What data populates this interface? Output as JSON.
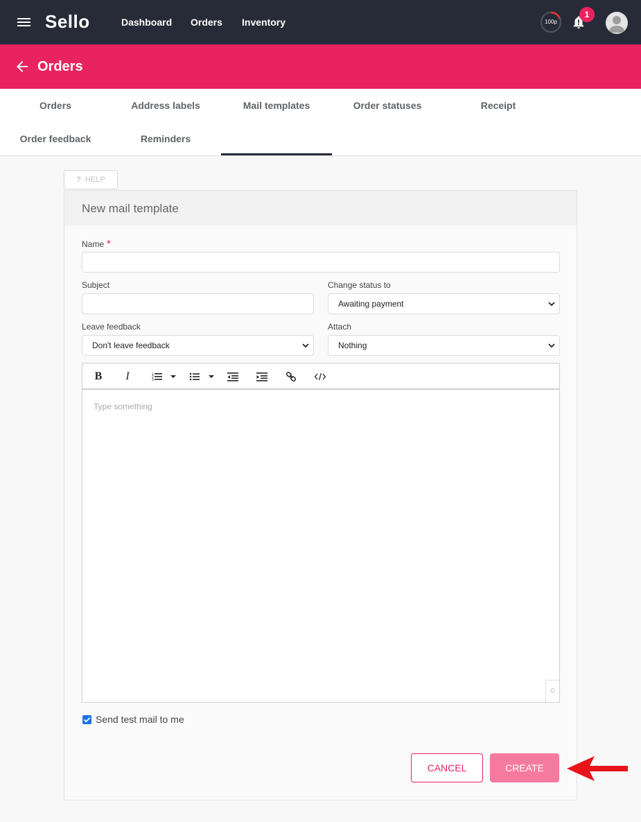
{
  "app": {
    "logo": "Sello"
  },
  "nav": {
    "items": [
      "Dashboard",
      "Orders",
      "Inventory"
    ]
  },
  "header": {
    "credits": "100p",
    "notification_count": "1",
    "accent_color": "#e9235f",
    "topbar_color": "#272b38"
  },
  "page": {
    "title": "Orders"
  },
  "tabs": [
    {
      "label": "Orders"
    },
    {
      "label": "Address labels"
    },
    {
      "label": "Mail templates"
    },
    {
      "label": "Order statuses"
    },
    {
      "label": "Receipt"
    },
    {
      "label": "Order feedback"
    },
    {
      "label": "Reminders"
    }
  ],
  "active_tab": "Mail templates",
  "help": {
    "label": "HELP"
  },
  "form": {
    "title": "New mail template",
    "name": {
      "label": "Name",
      "required_mark": "*",
      "value": ""
    },
    "subject": {
      "label": "Subject",
      "value": ""
    },
    "change_status": {
      "label": "Change status to",
      "value": "Awaiting payment"
    },
    "leave_feedback": {
      "label": "Leave feedback",
      "value": "Don't leave feedback"
    },
    "attach": {
      "label": "Attach",
      "value": "Nothing"
    },
    "editor": {
      "toolbar": [
        "bold-icon",
        "italic-icon",
        "ordered-list-icon",
        "ordered-list-dropdown-icon",
        "bullet-list-icon",
        "bullet-list-dropdown-icon",
        "outdent-icon",
        "indent-icon",
        "link-icon",
        "code-icon"
      ],
      "bold_glyph": "B",
      "italic_glyph": "I",
      "placeholder": "Type something",
      "char_count": "0"
    },
    "send_test": {
      "label": "Send test mail to me",
      "checked": true
    },
    "cancel_label": "CANCEL",
    "create_label": "CREATE"
  }
}
